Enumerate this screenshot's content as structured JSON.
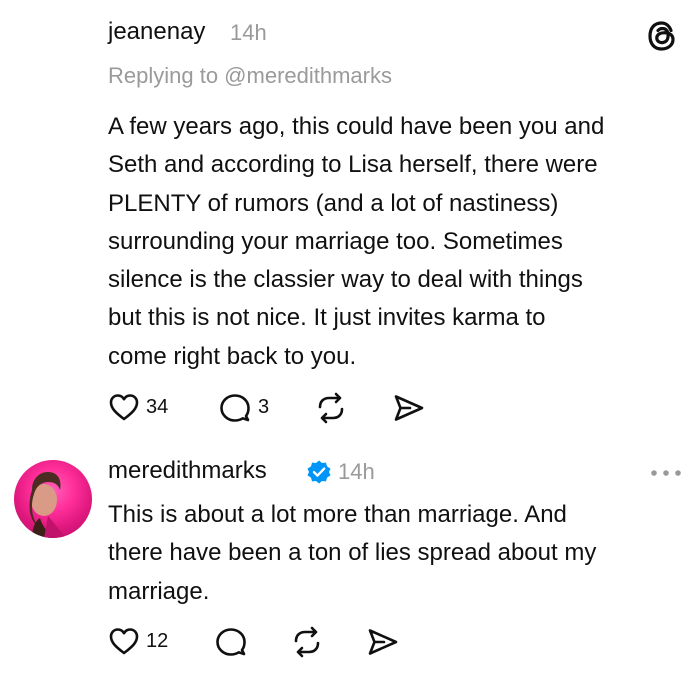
{
  "post1": {
    "username": "jeanenay",
    "time": "14h",
    "replying_to": "Replying to @meredithmarks",
    "body_lines": [
      "A few years ago, this could have been you and",
      "Seth and according to Lisa herself, there were",
      "PLENTY of rumors (and a lot of nastiness)",
      "surrounding your marriage too.  Sometimes",
      "silence is the classier way to deal with things",
      "but this is not nice.  It just invites karma to",
      "come right back to you."
    ],
    "likes": "34",
    "replies": "3",
    "icons": [
      "threads-logo",
      "heart-icon",
      "comment-icon",
      "repost-icon",
      "share-icon"
    ]
  },
  "post2": {
    "username": "meredithmarks",
    "time": "14h",
    "verified": true,
    "body_lines": [
      "This is about a lot more than marriage. And",
      "there have been a ton of lies spread about my",
      "marriage."
    ],
    "likes": "12",
    "icons": [
      "avatar",
      "verified-badge-icon",
      "more-options-icon",
      "heart-icon",
      "comment-icon",
      "repost-icon",
      "share-icon"
    ]
  },
  "colors": {
    "text": "#101010",
    "muted": "#9a9a9a",
    "verified": "#0095f6",
    "avatar_pink": "#ff2e9a"
  }
}
